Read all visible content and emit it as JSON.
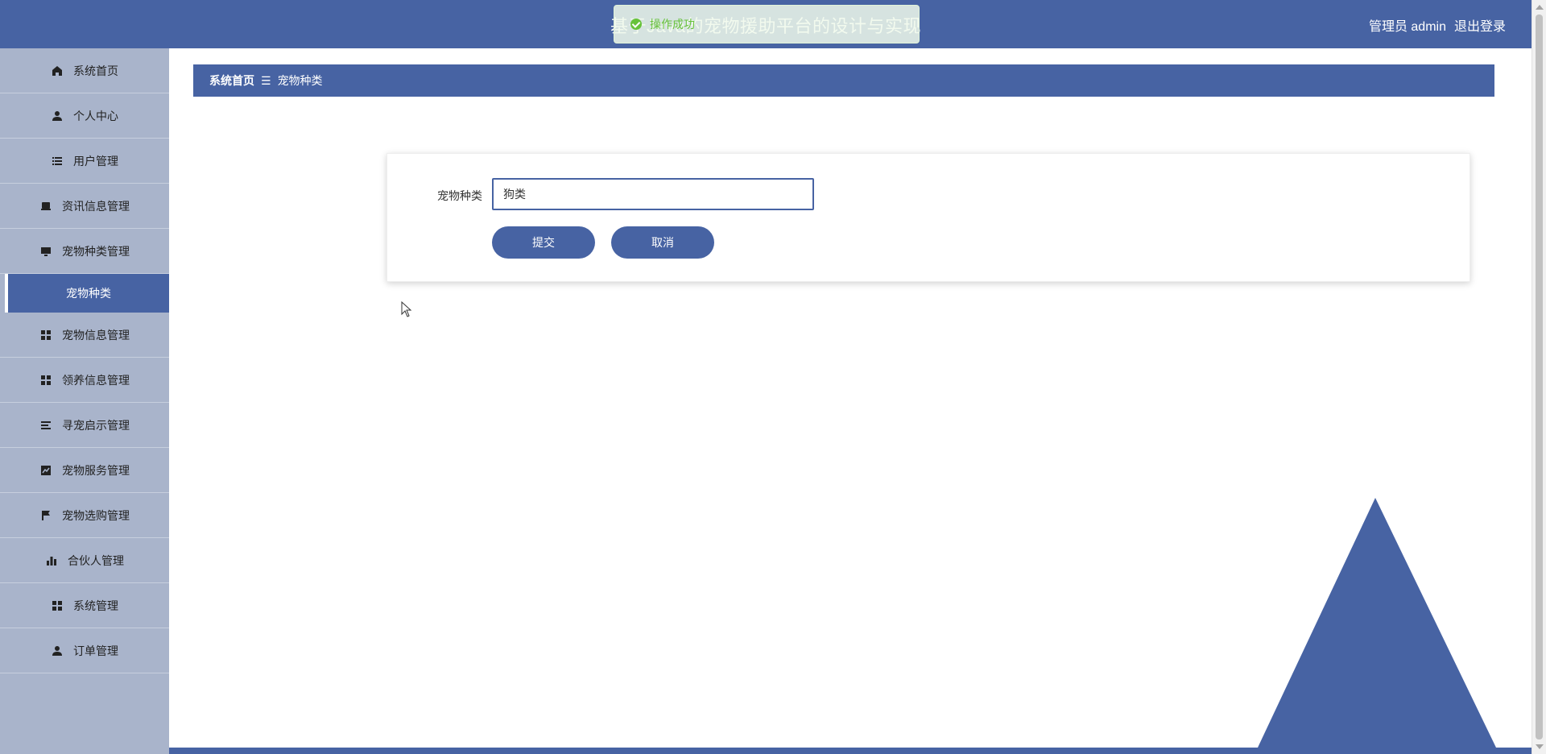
{
  "header": {
    "title": "基于Java的宠物援助平台的设计与实现",
    "user_label": "管理员 admin",
    "logout_label": "退出登录"
  },
  "toast": {
    "message": "操作成功",
    "icon": "check-circle-icon"
  },
  "sidebar": {
    "items": [
      {
        "label": "系统首页",
        "icon": "home-icon"
      },
      {
        "label": "个人中心",
        "icon": "user-icon"
      },
      {
        "label": "用户管理",
        "icon": "list-icon"
      },
      {
        "label": "资讯信息管理",
        "icon": "inbox-icon"
      },
      {
        "label": "宠物种类管理",
        "icon": "monitor-icon"
      },
      {
        "label": "宠物信息管理",
        "icon": "grid-icon"
      },
      {
        "label": "领养信息管理",
        "icon": "grid-icon"
      },
      {
        "label": "寻宠启示管理",
        "icon": "list-icon"
      },
      {
        "label": "宠物服务管理",
        "icon": "chart-icon"
      },
      {
        "label": "宠物选购管理",
        "icon": "flag-icon"
      },
      {
        "label": "合伙人管理",
        "icon": "bar-chart-icon"
      },
      {
        "label": "系统管理",
        "icon": "grid-icon"
      },
      {
        "label": "订单管理",
        "icon": "user-icon"
      }
    ],
    "active_sub": "宠物种类"
  },
  "breadcrumb": {
    "home": "系统首页",
    "separator": "☰",
    "current": "宠物种类"
  },
  "form": {
    "field_label": "宠物种类",
    "field_value": "狗类",
    "submit_label": "提交",
    "cancel_label": "取消"
  },
  "colors": {
    "primary": "#4763a3",
    "sidebar_bg": "#a9b4cb",
    "success": "#67c23a"
  }
}
